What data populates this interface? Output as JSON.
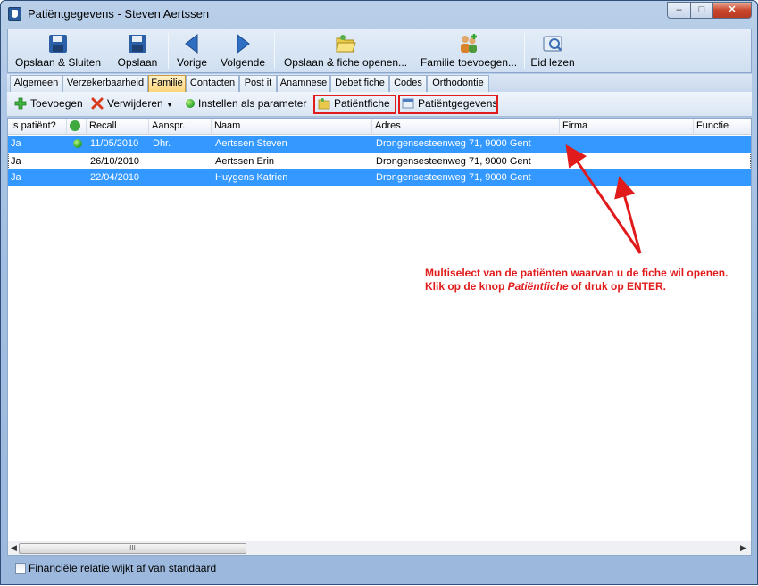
{
  "window": {
    "title": "Patiëntgegevens - Steven Aertssen",
    "min_label": "–",
    "max_label": "□",
    "close_label": "✕"
  },
  "toolbar": {
    "items": [
      {
        "label": "Opslaan & Sluiten",
        "icon": "floppy-disk-icon"
      },
      {
        "label": "Opslaan",
        "icon": "floppy-disk-icon"
      },
      {
        "label": "Vorige",
        "icon": "arrow-left-icon"
      },
      {
        "label": "Volgende",
        "icon": "arrow-right-icon"
      },
      {
        "label": "Opslaan & fiche openen...",
        "icon": "folder-open-icon"
      },
      {
        "label": "Familie toevoegen...",
        "icon": "family-icon"
      },
      {
        "label": "Eid lezen",
        "icon": "id-card-icon"
      }
    ]
  },
  "tabs": [
    "Algemeen",
    "Verzekerbaarheid",
    "Familie",
    "Contacten",
    "Post it",
    "Anamnese",
    "Debet fiche",
    "Codes",
    "Orthodontie"
  ],
  "active_tab": "Familie",
  "actions": {
    "add": "Toevoegen",
    "remove": "Verwijderen",
    "set_param": "Instellen als parameter",
    "patient_file": "Patiëntfiche",
    "patient_data": "Patiëntgegevens"
  },
  "grid": {
    "columns": [
      "Is patiënt?",
      "",
      "Recall",
      "Aanspr.",
      "Naam",
      "Adres",
      "Firma",
      "Functie"
    ],
    "rows": [
      {
        "is_patient": "Ja",
        "status": true,
        "recall": "11/05/2010",
        "aanspr": "Dhr.",
        "naam": "Aertssen Steven",
        "adres": "Drongensesteenweg 71, 9000 Gent",
        "firma": "",
        "functie": ""
      },
      {
        "is_patient": "Ja",
        "status": false,
        "recall": "26/10/2010",
        "aanspr": "",
        "naam": "Aertssen Erin",
        "adres": "Drongensesteenweg 71, 9000 Gent",
        "firma": "",
        "functie": ""
      },
      {
        "is_patient": "Ja",
        "status": false,
        "recall": "22/04/2010",
        "aanspr": "",
        "naam": "Huygens Katrien",
        "adres": "Drongensesteenweg 71, 9000 Gent",
        "firma": "",
        "functie": ""
      }
    ],
    "scroll_thumb": "III"
  },
  "annotation": {
    "line1": "Multiselect van de patiënten waarvan u de fiche wil openen.",
    "line2_a": "Klik op de knop ",
    "line2_em": "Patiëntfiche",
    "line2_b": " of druk op ENTER."
  },
  "footer": {
    "checkbox_label": "Financiële relatie wijkt af van standaard"
  },
  "colors": {
    "selection": "#3398ff",
    "annotation": "#e11b1b"
  }
}
